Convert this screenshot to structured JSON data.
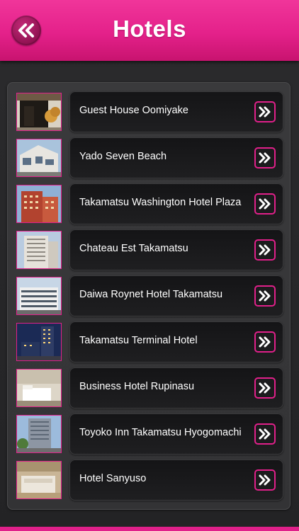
{
  "header": {
    "title": "Hotels",
    "back_icon": "double-chevron-left-icon"
  },
  "colors": {
    "accent": "#e4218a",
    "panel": "#363638",
    "card": "#1a1a1c"
  },
  "hotels": [
    {
      "name": "Guest House Oomiyake"
    },
    {
      "name": "Yado Seven Beach"
    },
    {
      "name": "Takamatsu Washington Hotel Plaza"
    },
    {
      "name": "Chateau Est Takamatsu"
    },
    {
      "name": "Daiwa Roynet Hotel Takamatsu"
    },
    {
      "name": "Takamatsu Terminal Hotel"
    },
    {
      "name": "Business Hotel Rupinasu"
    },
    {
      "name": "Toyoko Inn Takamatsu Hyogomachi"
    },
    {
      "name": "Hotel Sanyuso"
    }
  ],
  "row_action_icon": "double-chevron-right-icon"
}
